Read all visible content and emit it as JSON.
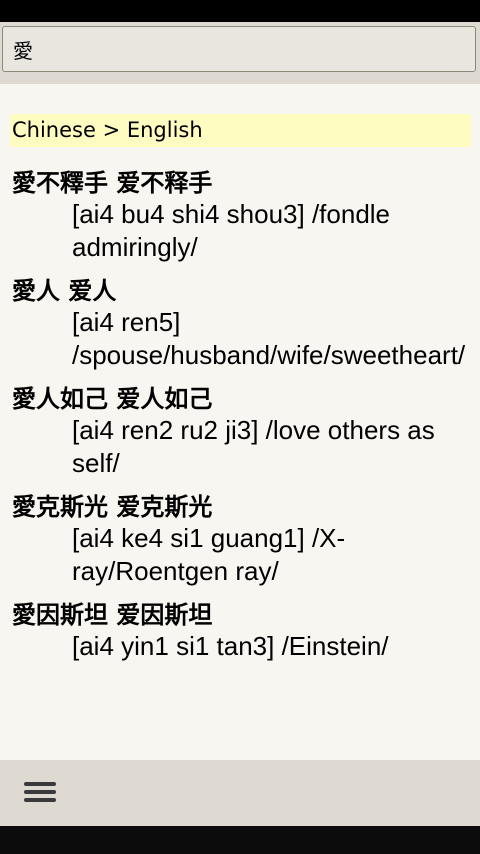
{
  "search": {
    "value": "愛"
  },
  "dictionary": {
    "direction": "Chinese > English"
  },
  "entries": [
    {
      "headword": "愛不釋手 爱不释手",
      "definition": "[ai4 bu4 shi4 shou3] /fondle admiringly/"
    },
    {
      "headword": "愛人 爱人",
      "definition": "[ai4 ren5] /spouse/husband/wife/sweetheart/"
    },
    {
      "headword": "愛人如己 爱人如己",
      "definition": "[ai4 ren2 ru2 ji3] /love others as self/"
    },
    {
      "headword": "愛克斯光 爱克斯光",
      "definition": "[ai4 ke4 si1 guang1] /X-ray/Roentgen ray/"
    },
    {
      "headword": "愛因斯坦 爱因斯坦",
      "definition": "[ai4 yin1 si1 tan3] /Einstein/"
    }
  ],
  "toolbar": {
    "menu_icon": "menu-icon"
  }
}
